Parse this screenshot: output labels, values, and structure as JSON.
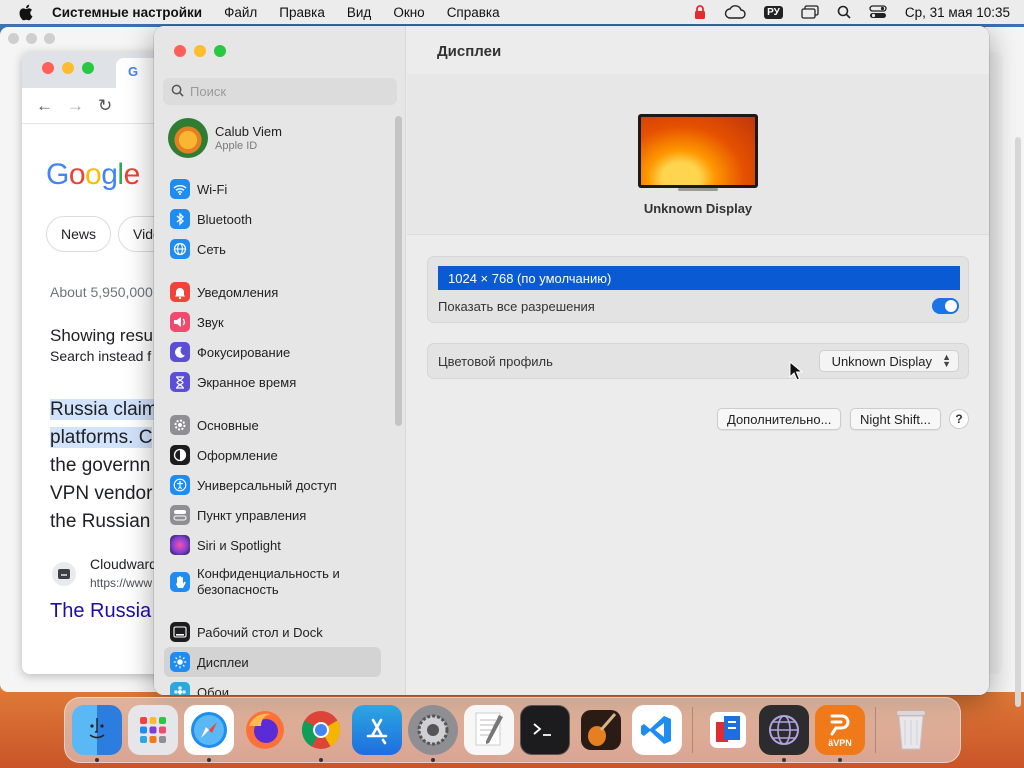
{
  "menubar": {
    "app_name": "Системные настройки",
    "items": [
      "Файл",
      "Правка",
      "Вид",
      "Окно",
      "Справка"
    ],
    "input_source": "РУ",
    "datetime": "Ср, 31 мая  10:35"
  },
  "browser": {
    "chips": [
      "News",
      "Vide"
    ],
    "about": "About 5,950,000",
    "showing": "Showing resu",
    "search_instead": "Search instead f",
    "snippet": [
      "Russia claim",
      "platforms. C",
      "the governn",
      "VPN vendor",
      "the Russian"
    ],
    "site_name": "Cloudward",
    "site_url": "https://www",
    "result_title": "The Russia"
  },
  "settings": {
    "search_placeholder": "Поиск",
    "account": {
      "name": "Calub Viem",
      "sub": "Apple ID"
    },
    "sidebar": {
      "group1": [
        {
          "label": "Wi-Fi",
          "color": "#1e8cf0"
        },
        {
          "label": "Bluetooth",
          "color": "#1e8cf0"
        },
        {
          "label": "Сеть",
          "color": "#1e8cf0"
        }
      ],
      "group2": [
        {
          "label": "Уведомления",
          "color": "#f0443a"
        },
        {
          "label": "Звук",
          "color": "#f04a6e"
        },
        {
          "label": "Фокусирование",
          "color": "#5b4fd6"
        },
        {
          "label": "Экранное время",
          "color": "#5b4fd6"
        }
      ],
      "group3": [
        {
          "label": "Основные",
          "color": "#8e8e93"
        },
        {
          "label": "Оформление",
          "color": "#1c1c1e"
        },
        {
          "label": "Универсальный доступ",
          "color": "#1e8cf0"
        },
        {
          "label": "Пункт управления",
          "color": "#8e8e93"
        },
        {
          "label": "Siri и Spotlight",
          "color": "#7b3fd6"
        },
        {
          "label": "Конфиденциальность и безопасность",
          "color": "#1e8cf0"
        }
      ],
      "group4": [
        {
          "label": "Рабочий стол и Dock",
          "color": "#1c1c1e"
        },
        {
          "label": "Дисплеи",
          "color": "#1e8cf0"
        },
        {
          "label": "Обои",
          "color": "#2ca7e0"
        }
      ]
    },
    "content": {
      "title": "Дисплеи",
      "display_name": "Unknown Display",
      "resolution": "1024 × 768 (по умолчанию)",
      "show_all": "Показать все разрешения",
      "show_all_enabled": true,
      "color_profile_label": "Цветовой профиль",
      "color_profile_value": "Unknown Display",
      "advanced_button": "Дополнительно...",
      "nightshift_button": "Night Shift...",
      "help": "?"
    }
  },
  "dock": {
    "apps": [
      {
        "name": "finder",
        "color": "#2b8de8",
        "running": true
      },
      {
        "name": "launchpad",
        "color": "#e5e5ea",
        "running": false
      },
      {
        "name": "safari",
        "color": "#ffffff",
        "running": true
      },
      {
        "name": "firefox",
        "color": "#5b2bd6",
        "running": false
      },
      {
        "name": "chrome",
        "color": "#ffffff",
        "running": true
      },
      {
        "name": "app-store",
        "color": "#1e8cf0",
        "running": false
      },
      {
        "name": "system-settings",
        "color": "#8e8e93",
        "running": true
      },
      {
        "name": "textedit",
        "color": "#f2f2f2",
        "running": false
      },
      {
        "name": "terminal",
        "color": "#1c1c1e",
        "running": false
      },
      {
        "name": "garageband",
        "color": "#4a3020",
        "running": false
      },
      {
        "name": "vscode",
        "color": "#ffffff",
        "running": false
      }
    ],
    "apps_right": [
      {
        "name": "parallels",
        "color": "#ffffff",
        "running": false
      },
      {
        "name": "network-radar",
        "color": "#2c2c2e",
        "running": true
      },
      {
        "name": "vpn",
        "color": "#f07a1a",
        "running": true,
        "label": "äVPN"
      },
      {
        "name": "trash",
        "color": "#e8e8ec",
        "running": false
      }
    ]
  }
}
